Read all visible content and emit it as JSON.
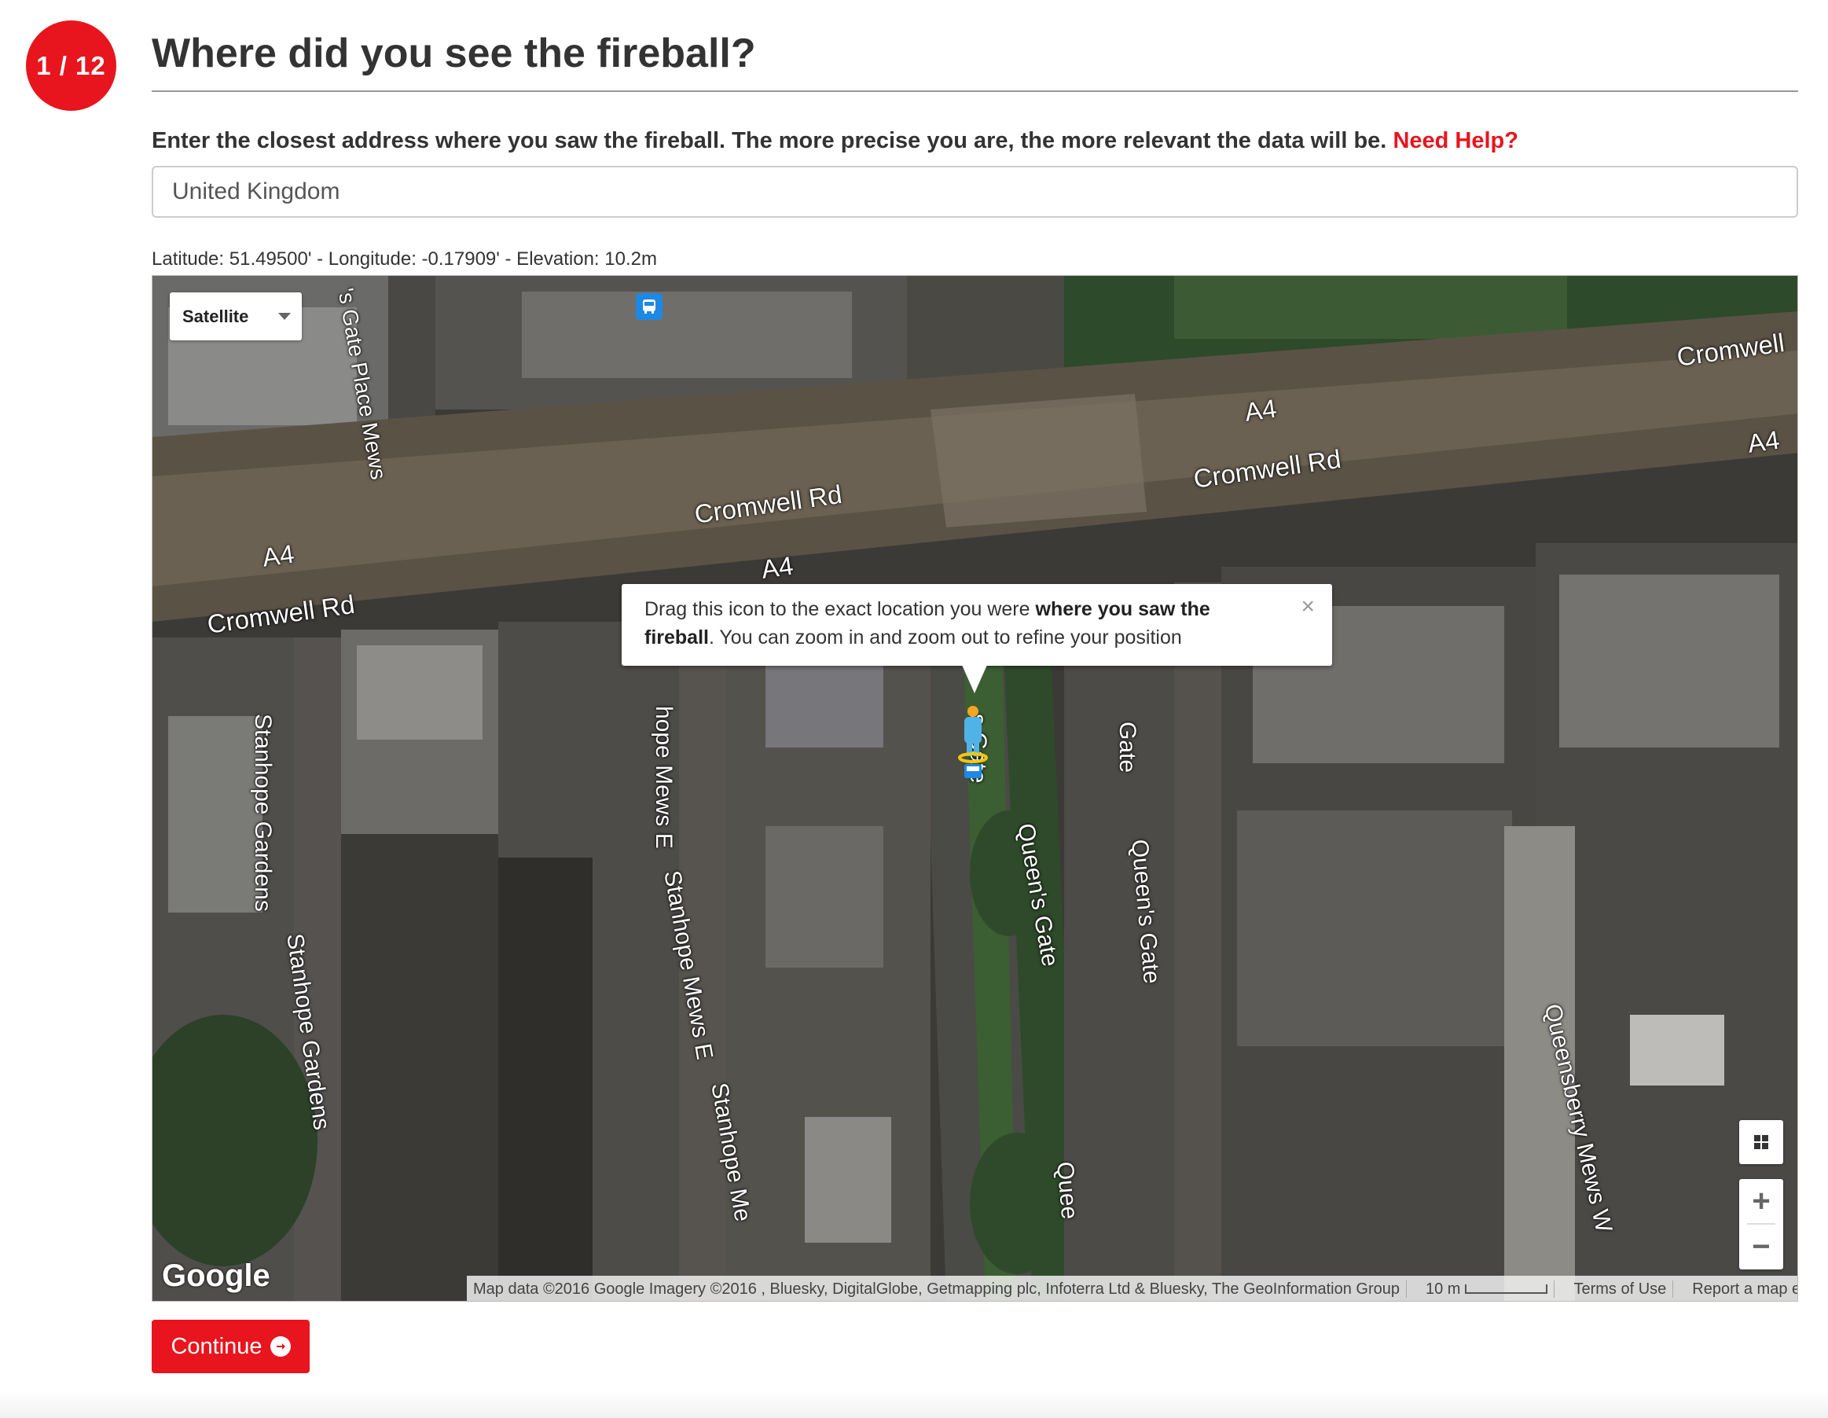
{
  "step": {
    "badge": "1 / 12"
  },
  "header": {
    "title": "Where did you see the fireball?"
  },
  "instruction": {
    "text": "Enter the closest address where you saw the fireball. The more precise you are, the more relevant the data will be.",
    "help_link": "Need Help?"
  },
  "address": {
    "value": "United Kingdom"
  },
  "coordinates": {
    "text": "Latitude: 51.49500' - Longitude: -0.17909' - Elevation: 10.2m"
  },
  "map": {
    "type_selector": "Satellite",
    "streets": [
      "'s Gate Place Mews",
      "Cromwell Rd",
      "A4",
      "A4",
      "Cromwell Rd",
      "A4",
      "A4",
      "Cromwell Rd",
      "Cromwell",
      "Stanhope Gardens",
      "hope Mews E",
      "s Gate",
      "Gate",
      "Queen's Gate",
      "Queen's Gate",
      "Stanhope Mews E",
      "Stanhope Gardens",
      "Stanhope Me",
      "Quee",
      "Queensberry Mews W"
    ],
    "tooltip": {
      "part1": "Drag this icon to the exact location you were ",
      "bold1": "where you saw the",
      "bold2": "fireball",
      "part2": ". You can zoom in and zoom out to refine your position",
      "close": "×"
    },
    "logo": "Google",
    "attribution": {
      "data": "Map data ©2016 Google Imagery ©2016 , Bluesky, DigitalGlobe, Getmapping plc, Infoterra Ltd & Bluesky, The GeoInformation Group",
      "scale": "10 m",
      "terms": "Terms of Use",
      "report": "Report a map error"
    },
    "zoom_in": "+",
    "zoom_out": "−"
  },
  "actions": {
    "continue": "Continue"
  },
  "colors": {
    "accent": "#e8151e",
    "bus_icon": "#1e88e5",
    "pegman": "#4fb3e8"
  },
  "icons": [
    "bus-stop-icon",
    "pegman-icon",
    "close-icon",
    "layers-icon",
    "chevron-down-icon",
    "arrow-right-circle-icon"
  ]
}
